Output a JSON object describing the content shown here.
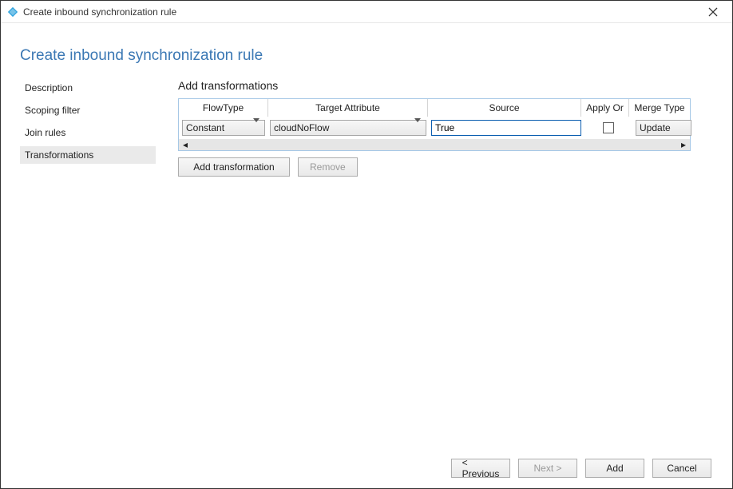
{
  "window": {
    "title": "Create inbound synchronization rule"
  },
  "page": {
    "heading": "Create inbound synchronization rule"
  },
  "sidebar": {
    "items": [
      {
        "label": "Description",
        "active": false
      },
      {
        "label": "Scoping filter",
        "active": false
      },
      {
        "label": "Join rules",
        "active": false
      },
      {
        "label": "Transformations",
        "active": true
      }
    ]
  },
  "section": {
    "title": "Add transformations"
  },
  "grid": {
    "headers": {
      "flowtype": "FlowType",
      "target": "Target Attribute",
      "source": "Source",
      "applyor": "Apply Or",
      "mergetype": "Merge Type"
    },
    "row": {
      "flowtype": "Constant",
      "target": "cloudNoFlow",
      "source": "True",
      "apply_once_checked": false,
      "mergetype": "Update"
    }
  },
  "buttons": {
    "add_transformation": "Add transformation",
    "remove": "Remove"
  },
  "footer": {
    "previous": "< Previous",
    "next": "Next >",
    "add": "Add",
    "cancel": "Cancel"
  }
}
